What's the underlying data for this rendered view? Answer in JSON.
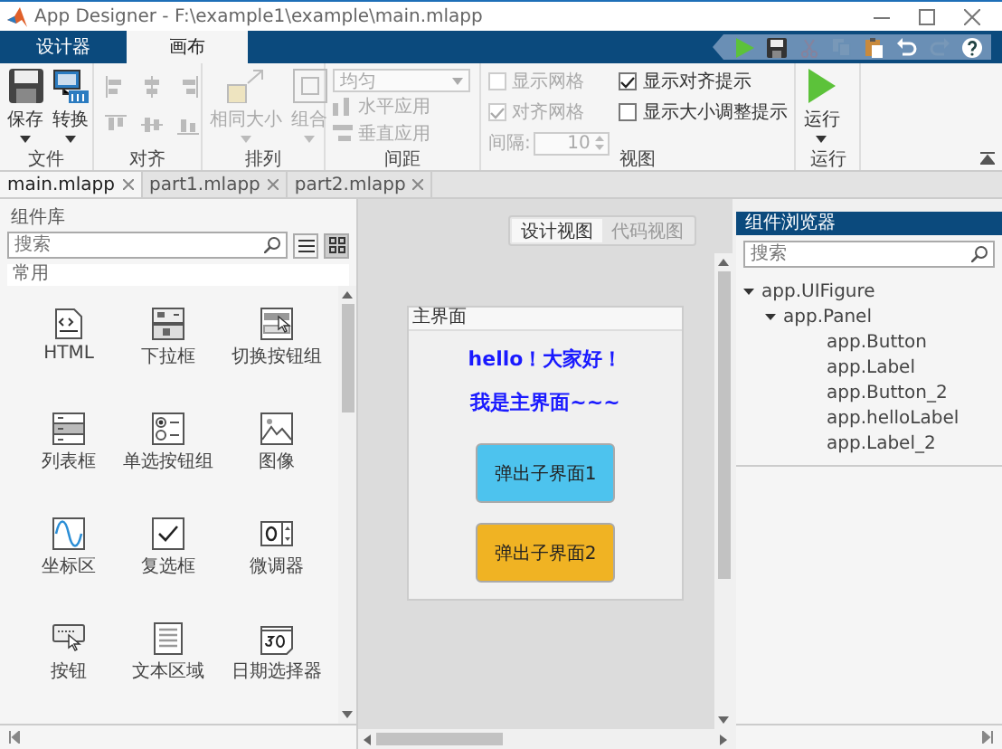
{
  "window": {
    "title": "App Designer - F:\\example1\\example\\main.mlapp"
  },
  "ribbon_tabs": [
    {
      "label": "设计器",
      "selected": false
    },
    {
      "label": "画布",
      "selected": true
    }
  ],
  "quick_access": [
    {
      "kind": "run",
      "disabled": false
    },
    {
      "kind": "save",
      "disabled": false
    },
    {
      "kind": "cut",
      "disabled": true
    },
    {
      "kind": "copy",
      "disabled": true
    },
    {
      "kind": "paste",
      "disabled": false
    },
    {
      "kind": "undo",
      "disabled": false
    },
    {
      "kind": "redo",
      "disabled": true
    },
    {
      "kind": "help",
      "disabled": false
    }
  ],
  "ribbon_groups": [
    {
      "kind": "file",
      "label": "文件",
      "buttons": [
        {
          "label": "保存",
          "disabled": false
        },
        {
          "label": "转换",
          "disabled": false
        }
      ]
    },
    {
      "kind": "align",
      "label": "对齐",
      "disabled": true
    },
    {
      "kind": "arrange",
      "label": "排列",
      "buttons": [
        {
          "label": "相同大小",
          "disabled": true
        },
        {
          "label": "组合",
          "disabled": true
        }
      ]
    },
    {
      "kind": "spacing",
      "label": "间距",
      "dropdown": {
        "value": "均匀",
        "disabled": true
      },
      "buttons": [
        {
          "label": "水平应用",
          "disabled": true
        },
        {
          "label": "垂直应用",
          "disabled": true
        }
      ]
    },
    {
      "kind": "view",
      "label": "视图",
      "checkboxes": [
        {
          "label": "显示网格",
          "checked": false,
          "disabled": true
        },
        {
          "label": "对齐网格",
          "checked": true,
          "disabled": true
        },
        {
          "label": "显示对齐提示",
          "checked": true,
          "disabled": false
        },
        {
          "label": "显示大小调整提示",
          "checked": false,
          "disabled": false
        }
      ],
      "spinner": {
        "label": "间隔:",
        "value": "10",
        "disabled": true
      }
    },
    {
      "kind": "run",
      "label": "运行",
      "buttons": [
        {
          "label": "运行",
          "disabled": false
        }
      ]
    }
  ],
  "document_tabs": [
    {
      "label": "main.mlapp",
      "selected": true
    },
    {
      "label": "part1.mlapp",
      "selected": false
    },
    {
      "label": "part2.mlapp",
      "selected": false
    }
  ],
  "component_library": {
    "title": "组件库",
    "search": {
      "placeholder": "搜索"
    },
    "view_modes": [
      {
        "kind": "list",
        "selected": false
      },
      {
        "kind": "grid",
        "selected": true
      }
    ],
    "section": "常用",
    "items": [
      {
        "label": "HTML",
        "kind": "html"
      },
      {
        "label": "下拉框",
        "kind": "dropdown"
      },
      {
        "label": "切换按钮组",
        "kind": "toggle_group"
      },
      {
        "label": "列表框",
        "kind": "listbox"
      },
      {
        "label": "单选按钮组",
        "kind": "radio_group"
      },
      {
        "label": "图像",
        "kind": "image"
      },
      {
        "label": "坐标区",
        "kind": "axes"
      },
      {
        "label": "复选框",
        "kind": "checkbox"
      },
      {
        "label": "微调器",
        "kind": "spinner"
      },
      {
        "label": "按钮",
        "kind": "button"
      },
      {
        "label": "文本区域",
        "kind": "textarea"
      },
      {
        "label": "日期选择器",
        "kind": "datepicker"
      }
    ]
  },
  "canvas": {
    "view_toggle": [
      {
        "label": "设计视图",
        "selected": true
      },
      {
        "label": "代码视图",
        "selected": false
      }
    ],
    "figure": {
      "title": "主界面",
      "labels": [
        "hello！大家好！",
        "我是主界面~~~"
      ],
      "buttons": [
        {
          "label": "弹出子界面1",
          "color": "#4dc3ee"
        },
        {
          "label": "弹出子界面2",
          "color": "#f0b323"
        }
      ]
    }
  },
  "component_browser": {
    "title": "组件浏览器",
    "search": {
      "placeholder": "搜索"
    },
    "tree": [
      {
        "label": "app.UIFigure",
        "expanded": true,
        "children": [
          {
            "label": "app.Panel",
            "expanded": true,
            "children": [
              {
                "label": "app.Button"
              },
              {
                "label": "app.Label"
              },
              {
                "label": "app.Button_2"
              },
              {
                "label": "app.helloLabel"
              },
              {
                "label": "app.Label_2"
              }
            ]
          }
        ]
      }
    ]
  }
}
